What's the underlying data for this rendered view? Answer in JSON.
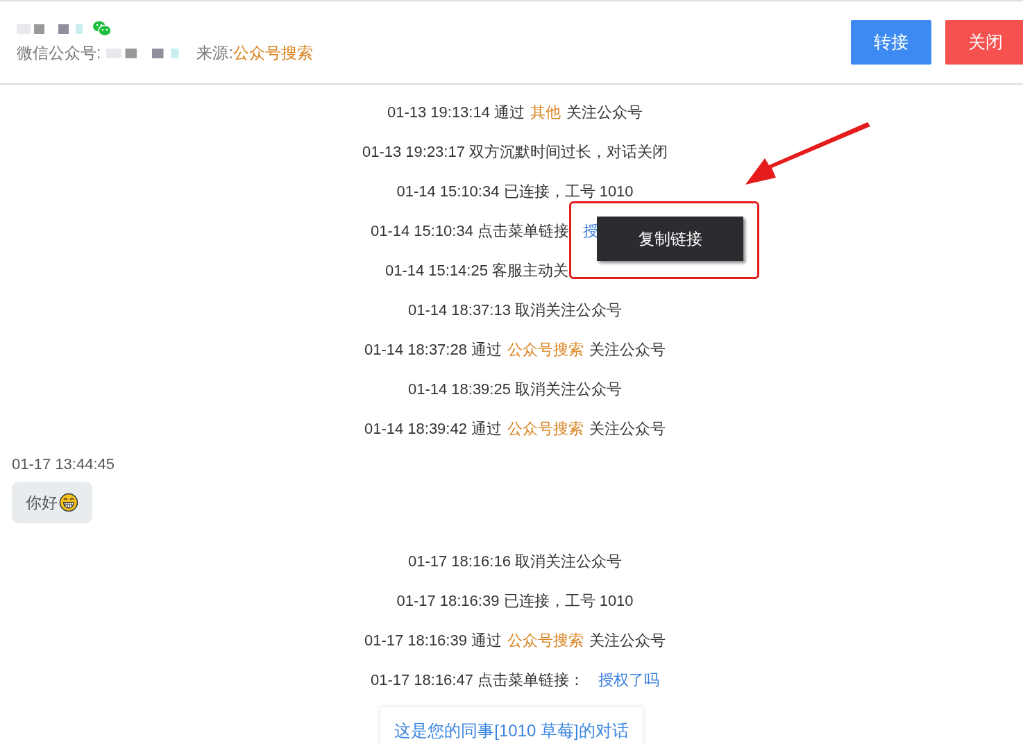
{
  "header": {
    "account_label": "微信公众号:",
    "source_label": "来源:",
    "source_value": "公众号搜索",
    "buttons": [
      {
        "kind": "primary",
        "label": "转接"
      },
      {
        "kind": "danger",
        "label": "关闭"
      }
    ]
  },
  "items": [
    {
      "kind": "event",
      "segments": [
        {
          "kind": "plain",
          "text": "01-13 19:13:14 通过"
        },
        {
          "kind": "source",
          "text": "其他"
        },
        {
          "kind": "plain",
          "text": "关注公众号"
        }
      ]
    },
    {
      "kind": "event",
      "segments": [
        {
          "kind": "plain",
          "text": "01-13 19:23:17 双方沉默时间过长，对话关闭"
        }
      ]
    },
    {
      "kind": "event",
      "segments": [
        {
          "kind": "plain",
          "text": "01-14 15:10:34 已连接，工号 1010"
        }
      ]
    },
    {
      "kind": "event",
      "menu": {
        "label": "复制链接"
      },
      "segments": [
        {
          "kind": "plain",
          "text": "01-14 15:10:34 点击菜单链接"
        },
        {
          "kind": "link",
          "text": "授"
        }
      ]
    },
    {
      "kind": "event",
      "segments": [
        {
          "kind": "plain",
          "text": "01-14 15:14:25 客服主动关"
        }
      ]
    },
    {
      "kind": "event",
      "segments": [
        {
          "kind": "plain",
          "text": "01-14 18:37:13 取消关注公众号"
        }
      ]
    },
    {
      "kind": "event",
      "segments": [
        {
          "kind": "plain",
          "text": "01-14 18:37:28 通过"
        },
        {
          "kind": "source",
          "text": "公众号搜索"
        },
        {
          "kind": "plain",
          "text": "关注公众号"
        }
      ]
    },
    {
      "kind": "event",
      "segments": [
        {
          "kind": "plain",
          "text": "01-14 18:39:25 取消关注公众号"
        }
      ]
    },
    {
      "kind": "event",
      "segments": [
        {
          "kind": "plain",
          "text": "01-14 18:39:42 通过"
        },
        {
          "kind": "source",
          "text": "公众号搜索"
        },
        {
          "kind": "plain",
          "text": "关注公众号"
        }
      ]
    },
    {
      "kind": "message",
      "time": "01-17 13:44:45",
      "text": "你好"
    },
    {
      "kind": "event",
      "segments": [
        {
          "kind": "plain",
          "text": "01-17 18:16:16 取消关注公众号"
        }
      ]
    },
    {
      "kind": "event",
      "segments": [
        {
          "kind": "plain",
          "text": "01-17 18:16:39 已连接，工号 1010"
        }
      ]
    },
    {
      "kind": "event",
      "segments": [
        {
          "kind": "plain",
          "text": "01-17 18:16:39 通过"
        },
        {
          "kind": "source",
          "text": "公众号搜索"
        },
        {
          "kind": "plain",
          "text": "关注公众号"
        }
      ]
    },
    {
      "kind": "event",
      "segments": [
        {
          "kind": "plain",
          "text": "01-17 18:16:47 点击菜单链接："
        },
        {
          "kind": "link",
          "text": "授权了吗"
        }
      ]
    },
    {
      "kind": "notice",
      "text": "这是您的同事[1010 草莓]的对话"
    }
  ]
}
